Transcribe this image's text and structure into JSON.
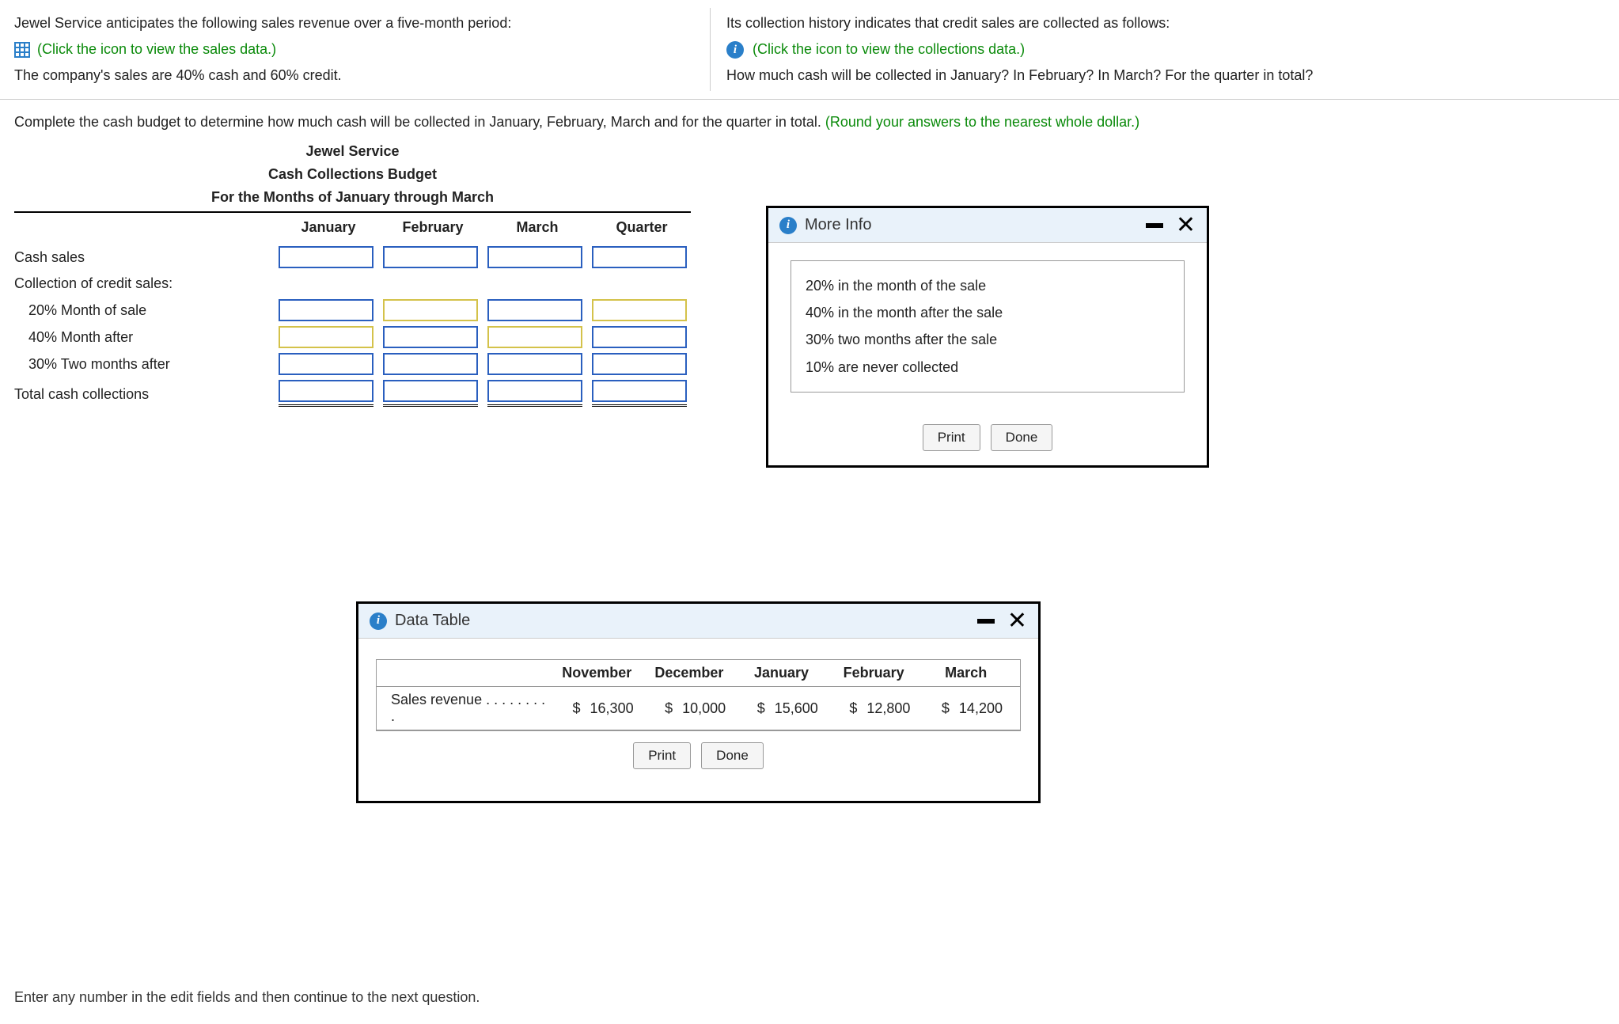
{
  "top_left": {
    "line1": "Jewel Service anticipates the following sales revenue over a five-month period:",
    "link": "(Click the icon to view the sales data.)",
    "line3": "The company's sales are 40% cash and 60% credit."
  },
  "top_right": {
    "line1": "Its collection history indicates that credit sales are collected as follows:",
    "link": "(Click the icon to view the collections data.)",
    "line3": "How much cash will be collected in January? In February? In March? For the quarter in total?"
  },
  "instruction": {
    "main": "Complete the cash budget to determine how much cash will be collected in January, February, March and for the quarter in total.",
    "hint": "(Round your answers to the nearest whole dollar.)"
  },
  "budget_title": {
    "l1": "Jewel Service",
    "l2": "Cash Collections Budget",
    "l3": "For the Months of January through March"
  },
  "columns": [
    "January",
    "February",
    "March",
    "Quarter"
  ],
  "rows": {
    "cash_sales": "Cash sales",
    "credit_header": "Collection of credit sales:",
    "r20": "20% Month of sale",
    "r40": "40% Month after",
    "r30": "30% Two months after",
    "total": "Total cash collections"
  },
  "moreinfo": {
    "title": "More Info",
    "lines": [
      "20% in the month of the sale",
      "40% in the month after the sale",
      "30% two months after the sale",
      "10% are never collected"
    ],
    "print": "Print",
    "done": "Done"
  },
  "datatable": {
    "title": "Data Table",
    "row_label": "Sales revenue . . . . . . . . .",
    "months": [
      "November",
      "December",
      "January",
      "February",
      "March"
    ],
    "currency": "$",
    "values": [
      "16,300",
      "10,000",
      "15,600",
      "12,800",
      "14,200"
    ],
    "print": "Print",
    "done": "Done"
  },
  "footer": "Enter any number in the edit fields and then continue to the next question.",
  "chart_data": {
    "type": "table",
    "title": "Sales revenue by month",
    "categories": [
      "November",
      "December",
      "January",
      "February",
      "March"
    ],
    "series": [
      {
        "name": "Sales revenue ($)",
        "values": [
          16300,
          10000,
          15600,
          12800,
          14200
        ]
      }
    ]
  }
}
